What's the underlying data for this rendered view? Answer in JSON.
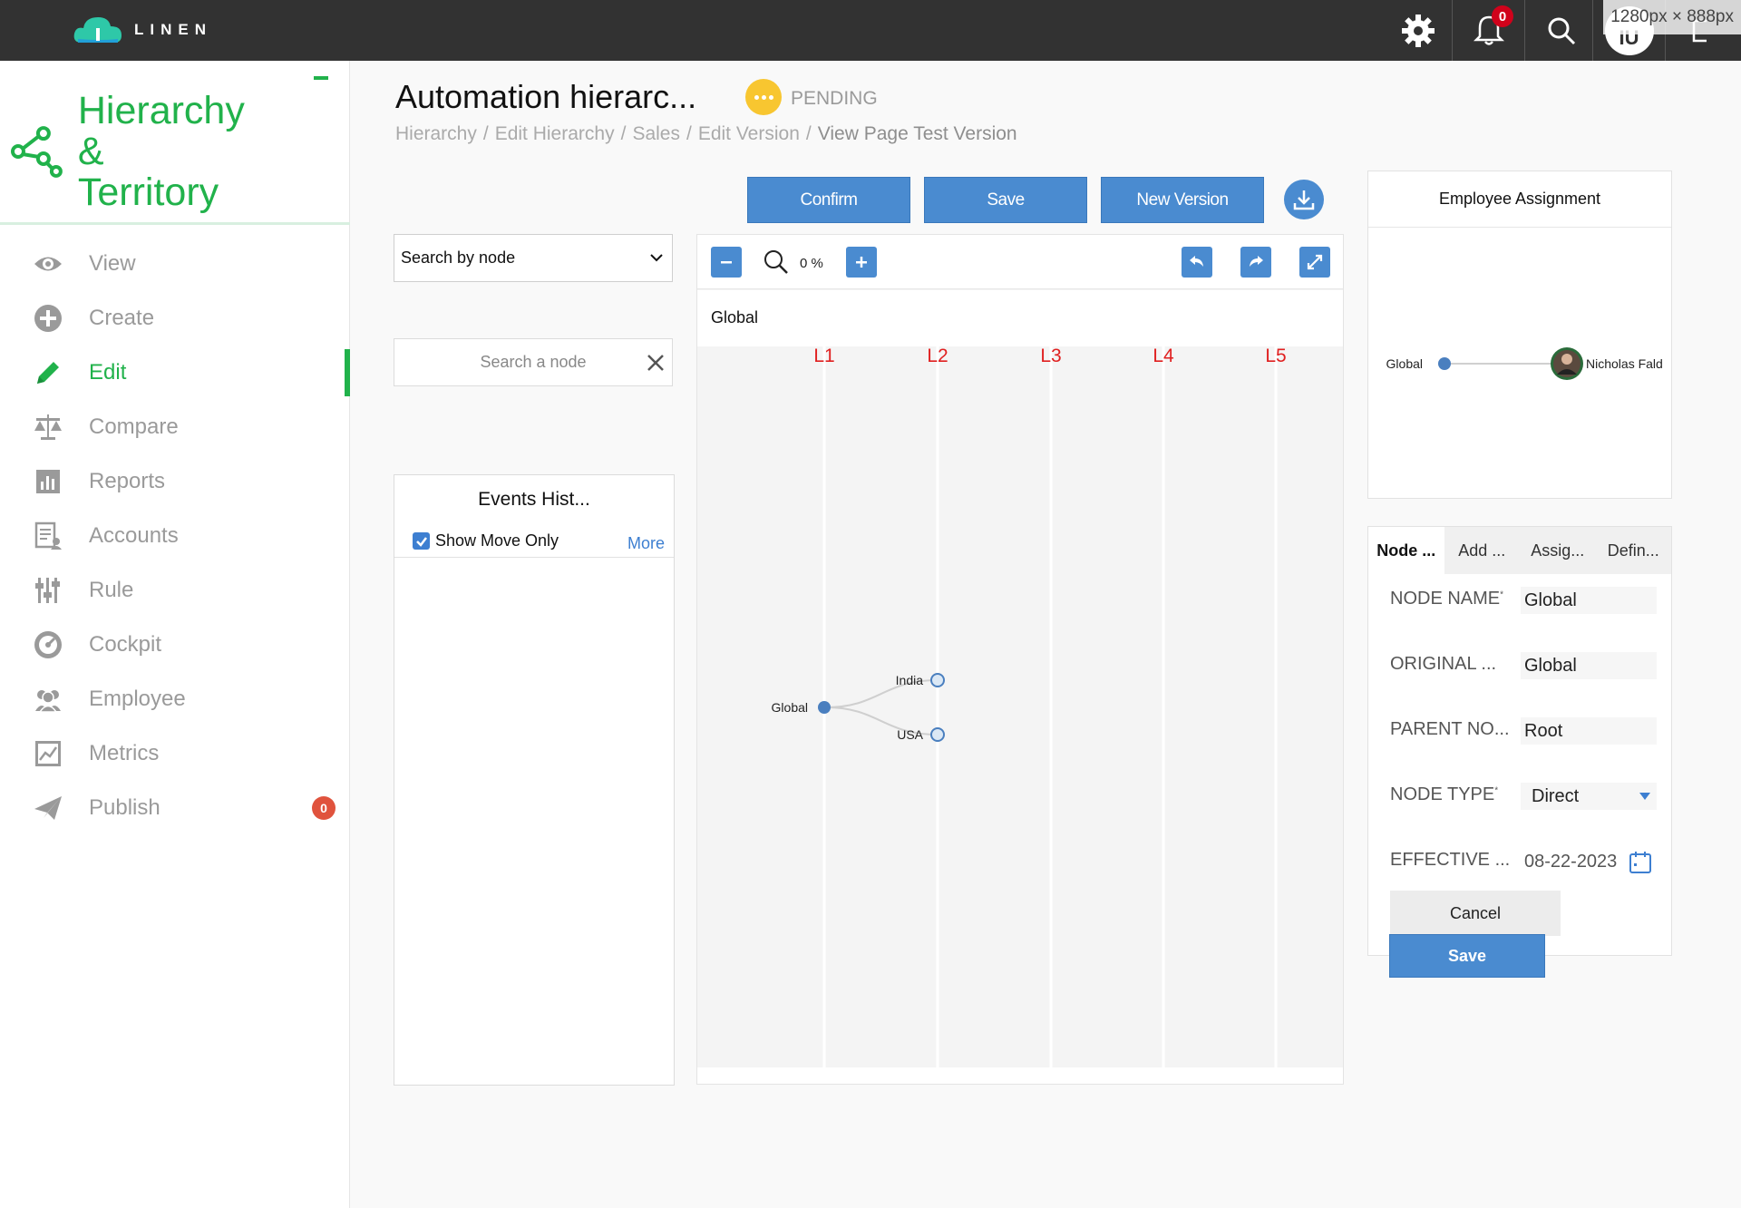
{
  "app": {
    "logo_text": "LINEN",
    "notification_count": "0",
    "user_initials": "IU",
    "viewport_label": "1280px × 888px"
  },
  "sidebar": {
    "brand_line1": "Hierarchy &",
    "brand_line2": "Territory",
    "items": [
      {
        "label": "View",
        "icon": "eye-icon"
      },
      {
        "label": "Create",
        "icon": "plus-circle-icon"
      },
      {
        "label": "Edit",
        "icon": "pencil-icon",
        "active": true
      },
      {
        "label": "Compare",
        "icon": "scales-icon"
      },
      {
        "label": "Reports",
        "icon": "bar-chart-icon"
      },
      {
        "label": "Accounts",
        "icon": "accounts-icon"
      },
      {
        "label": "Rule",
        "icon": "sliders-icon"
      },
      {
        "label": "Cockpit",
        "icon": "gauge-icon"
      },
      {
        "label": "Employee",
        "icon": "users-icon"
      },
      {
        "label": "Metrics",
        "icon": "line-chart-icon"
      },
      {
        "label": "Publish",
        "icon": "paper-plane-icon",
        "badge": "0"
      }
    ],
    "accent_color": "#21b24b"
  },
  "header": {
    "title": "Automation hierarc...",
    "status": "PENDING",
    "breadcrumb": [
      "Hierarchy",
      "Edit Hierarchy",
      "Sales",
      "Edit Version",
      "View Page Test Version"
    ],
    "separator": "/"
  },
  "actions": {
    "confirm": "Confirm",
    "save": "Save",
    "new_version": "New Version"
  },
  "search": {
    "select_value": "Search by node",
    "node_placeholder": "Search a node"
  },
  "events": {
    "title": "Events Hist...",
    "show_move_only": "Show Move Only",
    "show_move_only_checked": true,
    "more": "More"
  },
  "tree": {
    "zoom": "0 %",
    "root_header": "Global",
    "levels": [
      "L1",
      "L2",
      "L3",
      "L4",
      "L5"
    ],
    "nodes": [
      {
        "label": "Global",
        "level": 1
      },
      {
        "label": "India",
        "level": 2,
        "parent": "Global"
      },
      {
        "label": "USA",
        "level": 2,
        "parent": "Global"
      }
    ]
  },
  "employee_assignment": {
    "title": "Employee Assignment",
    "node": "Global",
    "employee": "Nicholas Fald"
  },
  "node_details": {
    "tabs": [
      "Node ...",
      "Add ...",
      "Assig...",
      "Defin..."
    ],
    "fields": [
      {
        "label": "NODE NAME",
        "required": true,
        "value": "Global"
      },
      {
        "label": "ORIGINAL ...",
        "required": false,
        "value": "Global"
      },
      {
        "label": "PARENT NO...",
        "required": false,
        "value": "Root"
      },
      {
        "label": "NODE TYPE",
        "required": true,
        "value": "Direct"
      },
      {
        "label": "EFFECTIVE ...",
        "required": false,
        "value": "08-22-2023"
      }
    ],
    "cancel": "Cancel",
    "save": "Save"
  },
  "colors": {
    "primary_button": "#4a8bd0",
    "level_label": "#e02020",
    "status": "#f8c630"
  }
}
